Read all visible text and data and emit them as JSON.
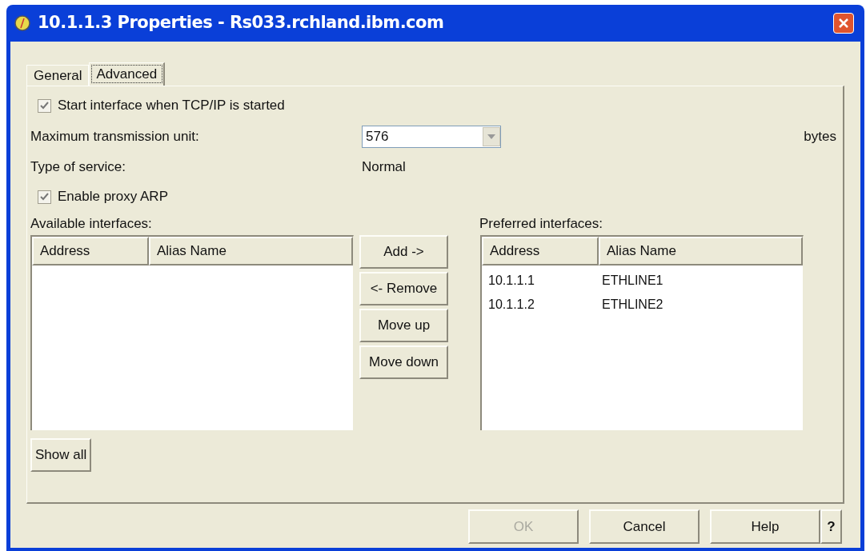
{
  "window": {
    "title": "10.1.1.3 Properties - Rs033.rchland.ibm.com"
  },
  "tabs": [
    {
      "label": "General",
      "selected": false
    },
    {
      "label": "Advanced",
      "selected": true
    }
  ],
  "start_checkbox": {
    "label": "Start interface when TCP/IP is started",
    "checked": true
  },
  "mtu": {
    "label": "Maximum transmission unit:",
    "value": "576",
    "unit": "bytes"
  },
  "type_of_service": {
    "label": "Type of service:",
    "value": "Normal"
  },
  "proxy_checkbox": {
    "label": "Enable proxy ARP",
    "checked": true
  },
  "available": {
    "label": "Available interfaces:",
    "columns": [
      "Address",
      "Alias Name"
    ]
  },
  "list_buttons": [
    {
      "label": "Add ->"
    },
    {
      "label": "<- Remove"
    },
    {
      "label": "Move up"
    },
    {
      "label": "Move down"
    }
  ],
  "preferred": {
    "label": "Preferred interfaces:",
    "columns": [
      "Address",
      "Alias Name"
    ],
    "rows": [
      {
        "address": "10.1.1.1",
        "alias": "ETHLINE1"
      },
      {
        "address": "10.1.1.2",
        "alias": "ETHLINE2"
      }
    ]
  },
  "show_all": "Show all",
  "footer_buttons": [
    {
      "label": "OK",
      "disabled": true
    },
    {
      "label": "Cancel",
      "disabled": false
    },
    {
      "label": "Help",
      "disabled": false
    }
  ],
  "help_glyph": "?"
}
